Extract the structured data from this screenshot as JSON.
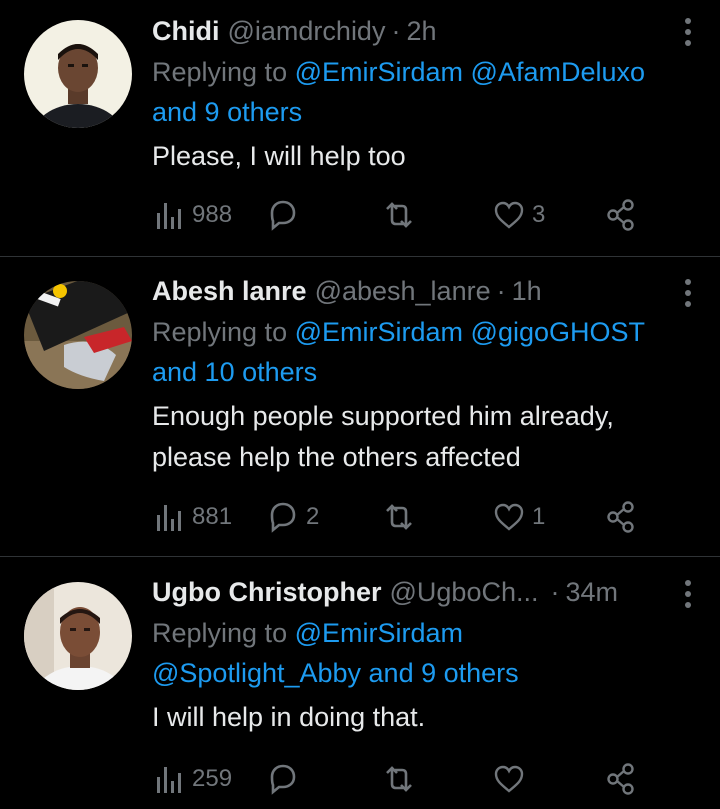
{
  "tweets": [
    {
      "name": "Chidi",
      "handle": "@iamdrchidy",
      "dot": "·",
      "time": "2h",
      "replying_prefix": "Replying to",
      "mentions": "@EmirSirdam @AfamDeluxo",
      "mentions_line2": "and 9 others",
      "text": "Please, I will help too",
      "text_line2": "",
      "views": "988",
      "replies": "",
      "retweets": "",
      "likes": "3"
    },
    {
      "name": "Abesh lanre",
      "handle": "@abesh_lanre",
      "dot": "·",
      "time": "1h",
      "replying_prefix": "Replying to",
      "mentions": "@EmirSirdam @gigoGHOST",
      "mentions_line2": "and 10 others",
      "text": "Enough people supported him already,",
      "text_line2": "please help the others affected",
      "views": "881",
      "replies": "2",
      "retweets": "",
      "likes": "1"
    },
    {
      "name": "Ugbo Christopher",
      "handle": "@UgboCh...",
      "dot": "·",
      "time": "34m",
      "replying_prefix": "Replying to",
      "mentions": "@EmirSirdam",
      "mentions_line2": "@Spotlight_Abby and 9 others",
      "text": "I will help in doing that.",
      "text_line2": "",
      "views": "259",
      "replies": "",
      "retweets": "",
      "likes": ""
    }
  ],
  "colors": {
    "background": "#000000",
    "text": "#e7e9ea",
    "secondary": "#71767b",
    "link": "#1d9bf0",
    "divider": "#2f3336"
  },
  "icons": [
    "views-icon",
    "reply-icon",
    "retweet-icon",
    "like-icon",
    "share-icon",
    "more-icon"
  ]
}
